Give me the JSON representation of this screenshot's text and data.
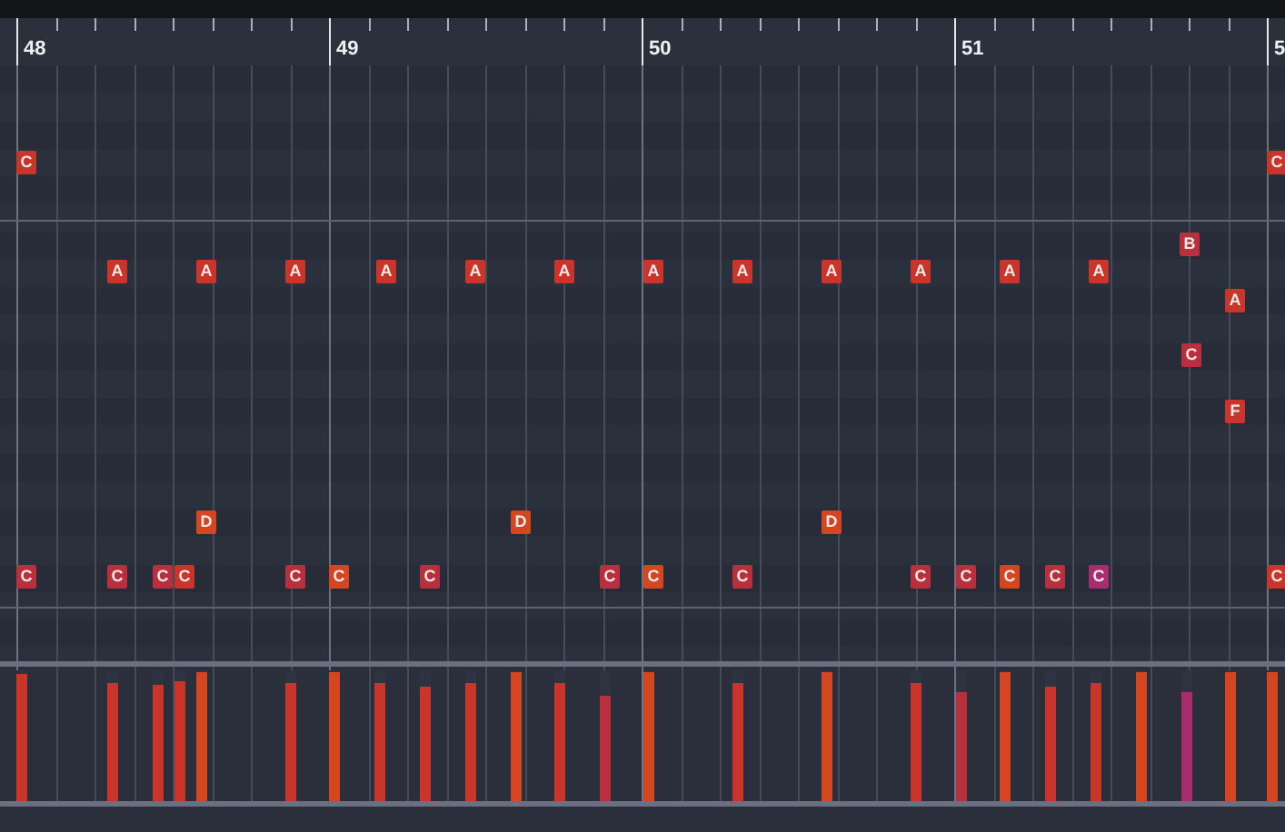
{
  "ruler": {
    "bars": [
      "48",
      "49",
      "50",
      "51",
      "5"
    ]
  },
  "notes": [
    {
      "label": "C",
      "color": "#c9352b"
    },
    {
      "label": "C",
      "color": "#c9352b"
    },
    {
      "label": "A",
      "color": "#c9352b"
    },
    {
      "label": "A",
      "color": "#c9352b"
    },
    {
      "label": "A",
      "color": "#c9352b"
    },
    {
      "label": "A",
      "color": "#c9352b"
    },
    {
      "label": "A",
      "color": "#c9352b"
    },
    {
      "label": "A",
      "color": "#c9352b"
    },
    {
      "label": "A",
      "color": "#c9352b"
    },
    {
      "label": "A",
      "color": "#c9352b"
    },
    {
      "label": "A",
      "color": "#c9352b"
    },
    {
      "label": "A",
      "color": "#c9352b"
    },
    {
      "label": "A",
      "color": "#c9352b"
    },
    {
      "label": "A",
      "color": "#c9352b"
    },
    {
      "label": "B",
      "color": "#b8303e"
    },
    {
      "label": "A",
      "color": "#c9352b"
    },
    {
      "label": "C",
      "color": "#b8303e"
    },
    {
      "label": "F",
      "color": "#c9352b"
    },
    {
      "label": "D",
      "color": "#d4461f"
    },
    {
      "label": "D",
      "color": "#d4461f"
    },
    {
      "label": "D",
      "color": "#d4461f"
    },
    {
      "label": "C",
      "color": "#b8303e"
    },
    {
      "label": "C",
      "color": "#b8303e"
    },
    {
      "label": "C",
      "color": "#b8303e"
    },
    {
      "label": "C",
      "color": "#c9352b"
    },
    {
      "label": "C",
      "color": "#b8303e"
    },
    {
      "label": "C",
      "color": "#d4461f"
    },
    {
      "label": "C",
      "color": "#b8303e"
    },
    {
      "label": "C",
      "color": "#b8303e"
    },
    {
      "label": "C",
      "color": "#d4461f"
    },
    {
      "label": "C",
      "color": "#b8303e"
    },
    {
      "label": "C",
      "color": "#b8303e"
    },
    {
      "label": "C",
      "color": "#b8303e"
    },
    {
      "label": "C",
      "color": "#d4461f"
    },
    {
      "label": "C",
      "color": "#b8303e"
    },
    {
      "label": "C",
      "color": "#a82c6e"
    },
    {
      "label": "C",
      "color": "#c9352b"
    }
  ],
  "velocities": [
    {
      "level": 0.97,
      "color": "#c9352b"
    },
    {
      "level": 0.9,
      "color": "#c9352b"
    },
    {
      "level": 0.89,
      "color": "#c9352b"
    },
    {
      "level": 0.92,
      "color": "#c9352b"
    },
    {
      "level": 0.98,
      "color": "#d4461f"
    },
    {
      "level": 0.9,
      "color": "#c9352b"
    },
    {
      "level": 0.98,
      "color": "#d4461f"
    },
    {
      "level": 0.9,
      "color": "#c9352b"
    },
    {
      "level": 0.87,
      "color": "#c9352b"
    },
    {
      "level": 0.9,
      "color": "#c9352b"
    },
    {
      "level": 0.98,
      "color": "#d4461f"
    },
    {
      "level": 0.9,
      "color": "#c9352b"
    },
    {
      "level": 0.8,
      "color": "#b8303e"
    },
    {
      "level": 0.98,
      "color": "#d4461f"
    },
    {
      "level": 0.9,
      "color": "#c9352b"
    },
    {
      "level": 0.98,
      "color": "#d4461f"
    },
    {
      "level": 0.9,
      "color": "#c9352b"
    },
    {
      "level": 0.83,
      "color": "#b8303e"
    },
    {
      "level": 0.98,
      "color": "#d4461f"
    },
    {
      "level": 0.87,
      "color": "#c9352b"
    },
    {
      "level": 0.9,
      "color": "#c9352b"
    },
    {
      "level": 0.98,
      "color": "#d4461f"
    },
    {
      "level": 0.83,
      "color": "#a82c6e"
    },
    {
      "level": 0.98,
      "color": "#d4461f"
    },
    {
      "level": 0.98,
      "color": "#d4461f"
    }
  ]
}
